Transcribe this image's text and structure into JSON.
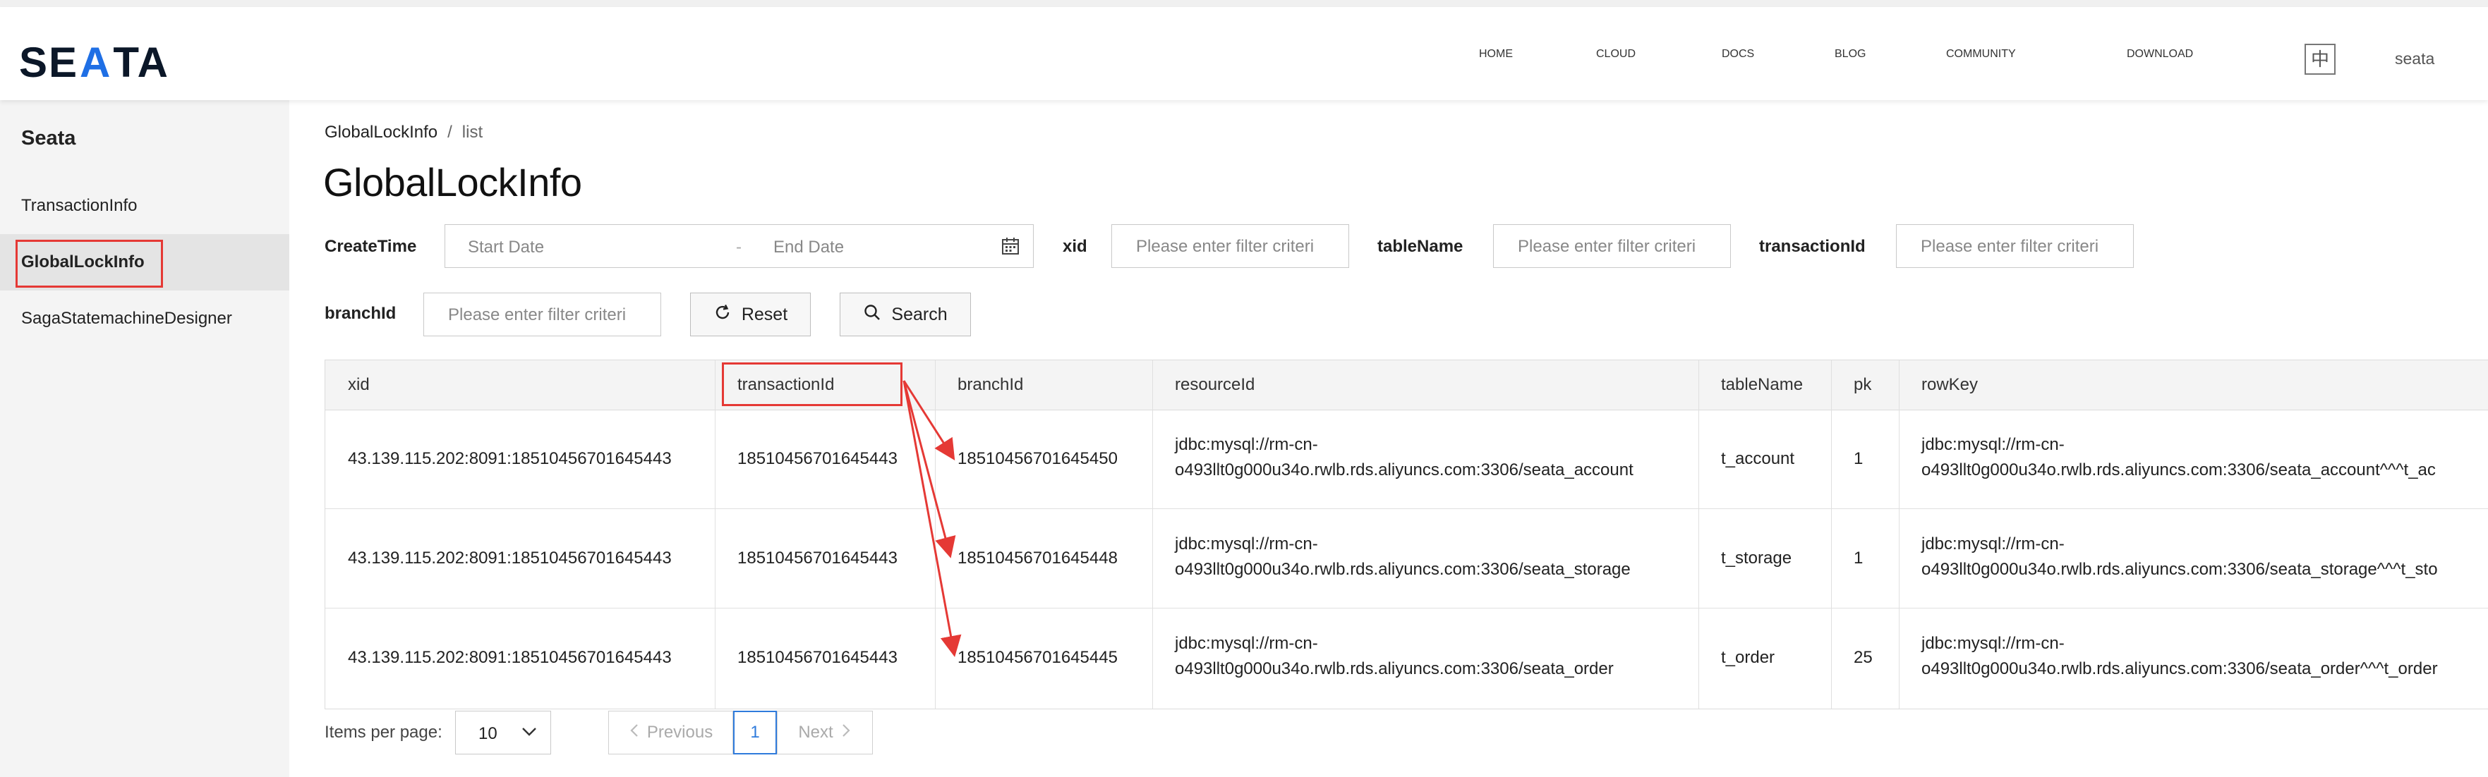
{
  "header": {
    "logo": {
      "left": "SE",
      "mid": "A",
      "right": "TA",
      "accent_color": "#1f6fe5"
    },
    "nav": [
      "HOME",
      "CLOUD",
      "DOCS",
      "BLOG",
      "COMMUNITY",
      "DOWNLOAD"
    ],
    "lang_toggle": "中",
    "user": "seata"
  },
  "sidebar": {
    "title": "Seata",
    "items": [
      {
        "label": "TransactionInfo"
      },
      {
        "label": "GlobalLockInfo"
      },
      {
        "label": "SagaStatemachineDesigner"
      }
    ]
  },
  "breadcrumb": {
    "root": "GlobalLockInfo",
    "sep": "/",
    "current": "list"
  },
  "page_title": "GlobalLockInfo",
  "filters": {
    "create_time_label": "CreateTime",
    "start_placeholder": "Start Date",
    "range_sep": "-",
    "end_placeholder": "End Date",
    "xid_label": "xid",
    "table_name_label": "tableName",
    "transaction_id_label": "transactionId",
    "branch_id_label": "branchId",
    "input_placeholder": "Please enter filter criteri"
  },
  "buttons": {
    "reset": "Reset",
    "search": "Search"
  },
  "table": {
    "columns": [
      "xid",
      "transactionId",
      "branchId",
      "resourceId",
      "tableName",
      "pk",
      "rowKey"
    ],
    "rows": [
      {
        "xid": "43.139.115.202:8091:18510456701645443",
        "transactionId": "18510456701645443",
        "branchId": "18510456701645450",
        "resourceId_1": "jdbc:mysql://rm-cn-",
        "resourceId_2": "o493llt0g000u34o.rwlb.rds.aliyuncs.com:3306/seata_account",
        "tableName": "t_account",
        "pk": "1",
        "rowKey_1": "jdbc:mysql://rm-cn-",
        "rowKey_2": "o493llt0g000u34o.rwlb.rds.aliyuncs.com:3306/seata_account^^^t_ac"
      },
      {
        "xid": "43.139.115.202:8091:18510456701645443",
        "transactionId": "18510456701645443",
        "branchId": "18510456701645448",
        "resourceId_1": "jdbc:mysql://rm-cn-",
        "resourceId_2": "o493llt0g000u34o.rwlb.rds.aliyuncs.com:3306/seata_storage",
        "tableName": "t_storage",
        "pk": "1",
        "rowKey_1": "jdbc:mysql://rm-cn-",
        "rowKey_2": "o493llt0g000u34o.rwlb.rds.aliyuncs.com:3306/seata_storage^^^t_sto"
      },
      {
        "xid": "43.139.115.202:8091:18510456701645443",
        "transactionId": "18510456701645443",
        "branchId": "18510456701645445",
        "resourceId_1": "jdbc:mysql://rm-cn-",
        "resourceId_2": "o493llt0g000u34o.rwlb.rds.aliyuncs.com:3306/seata_order",
        "tableName": "t_order",
        "pk": "25",
        "rowKey_1": "jdbc:mysql://rm-cn-",
        "rowKey_2": "o493llt0g000u34o.rwlb.rds.aliyuncs.com:3306/seata_order^^^t_order"
      }
    ]
  },
  "pagination": {
    "items_per_page_label": "Items per page:",
    "items_per_page_value": "10",
    "previous": "Previous",
    "current_page": "1",
    "next": "Next"
  },
  "annotation_color": "#e53935"
}
